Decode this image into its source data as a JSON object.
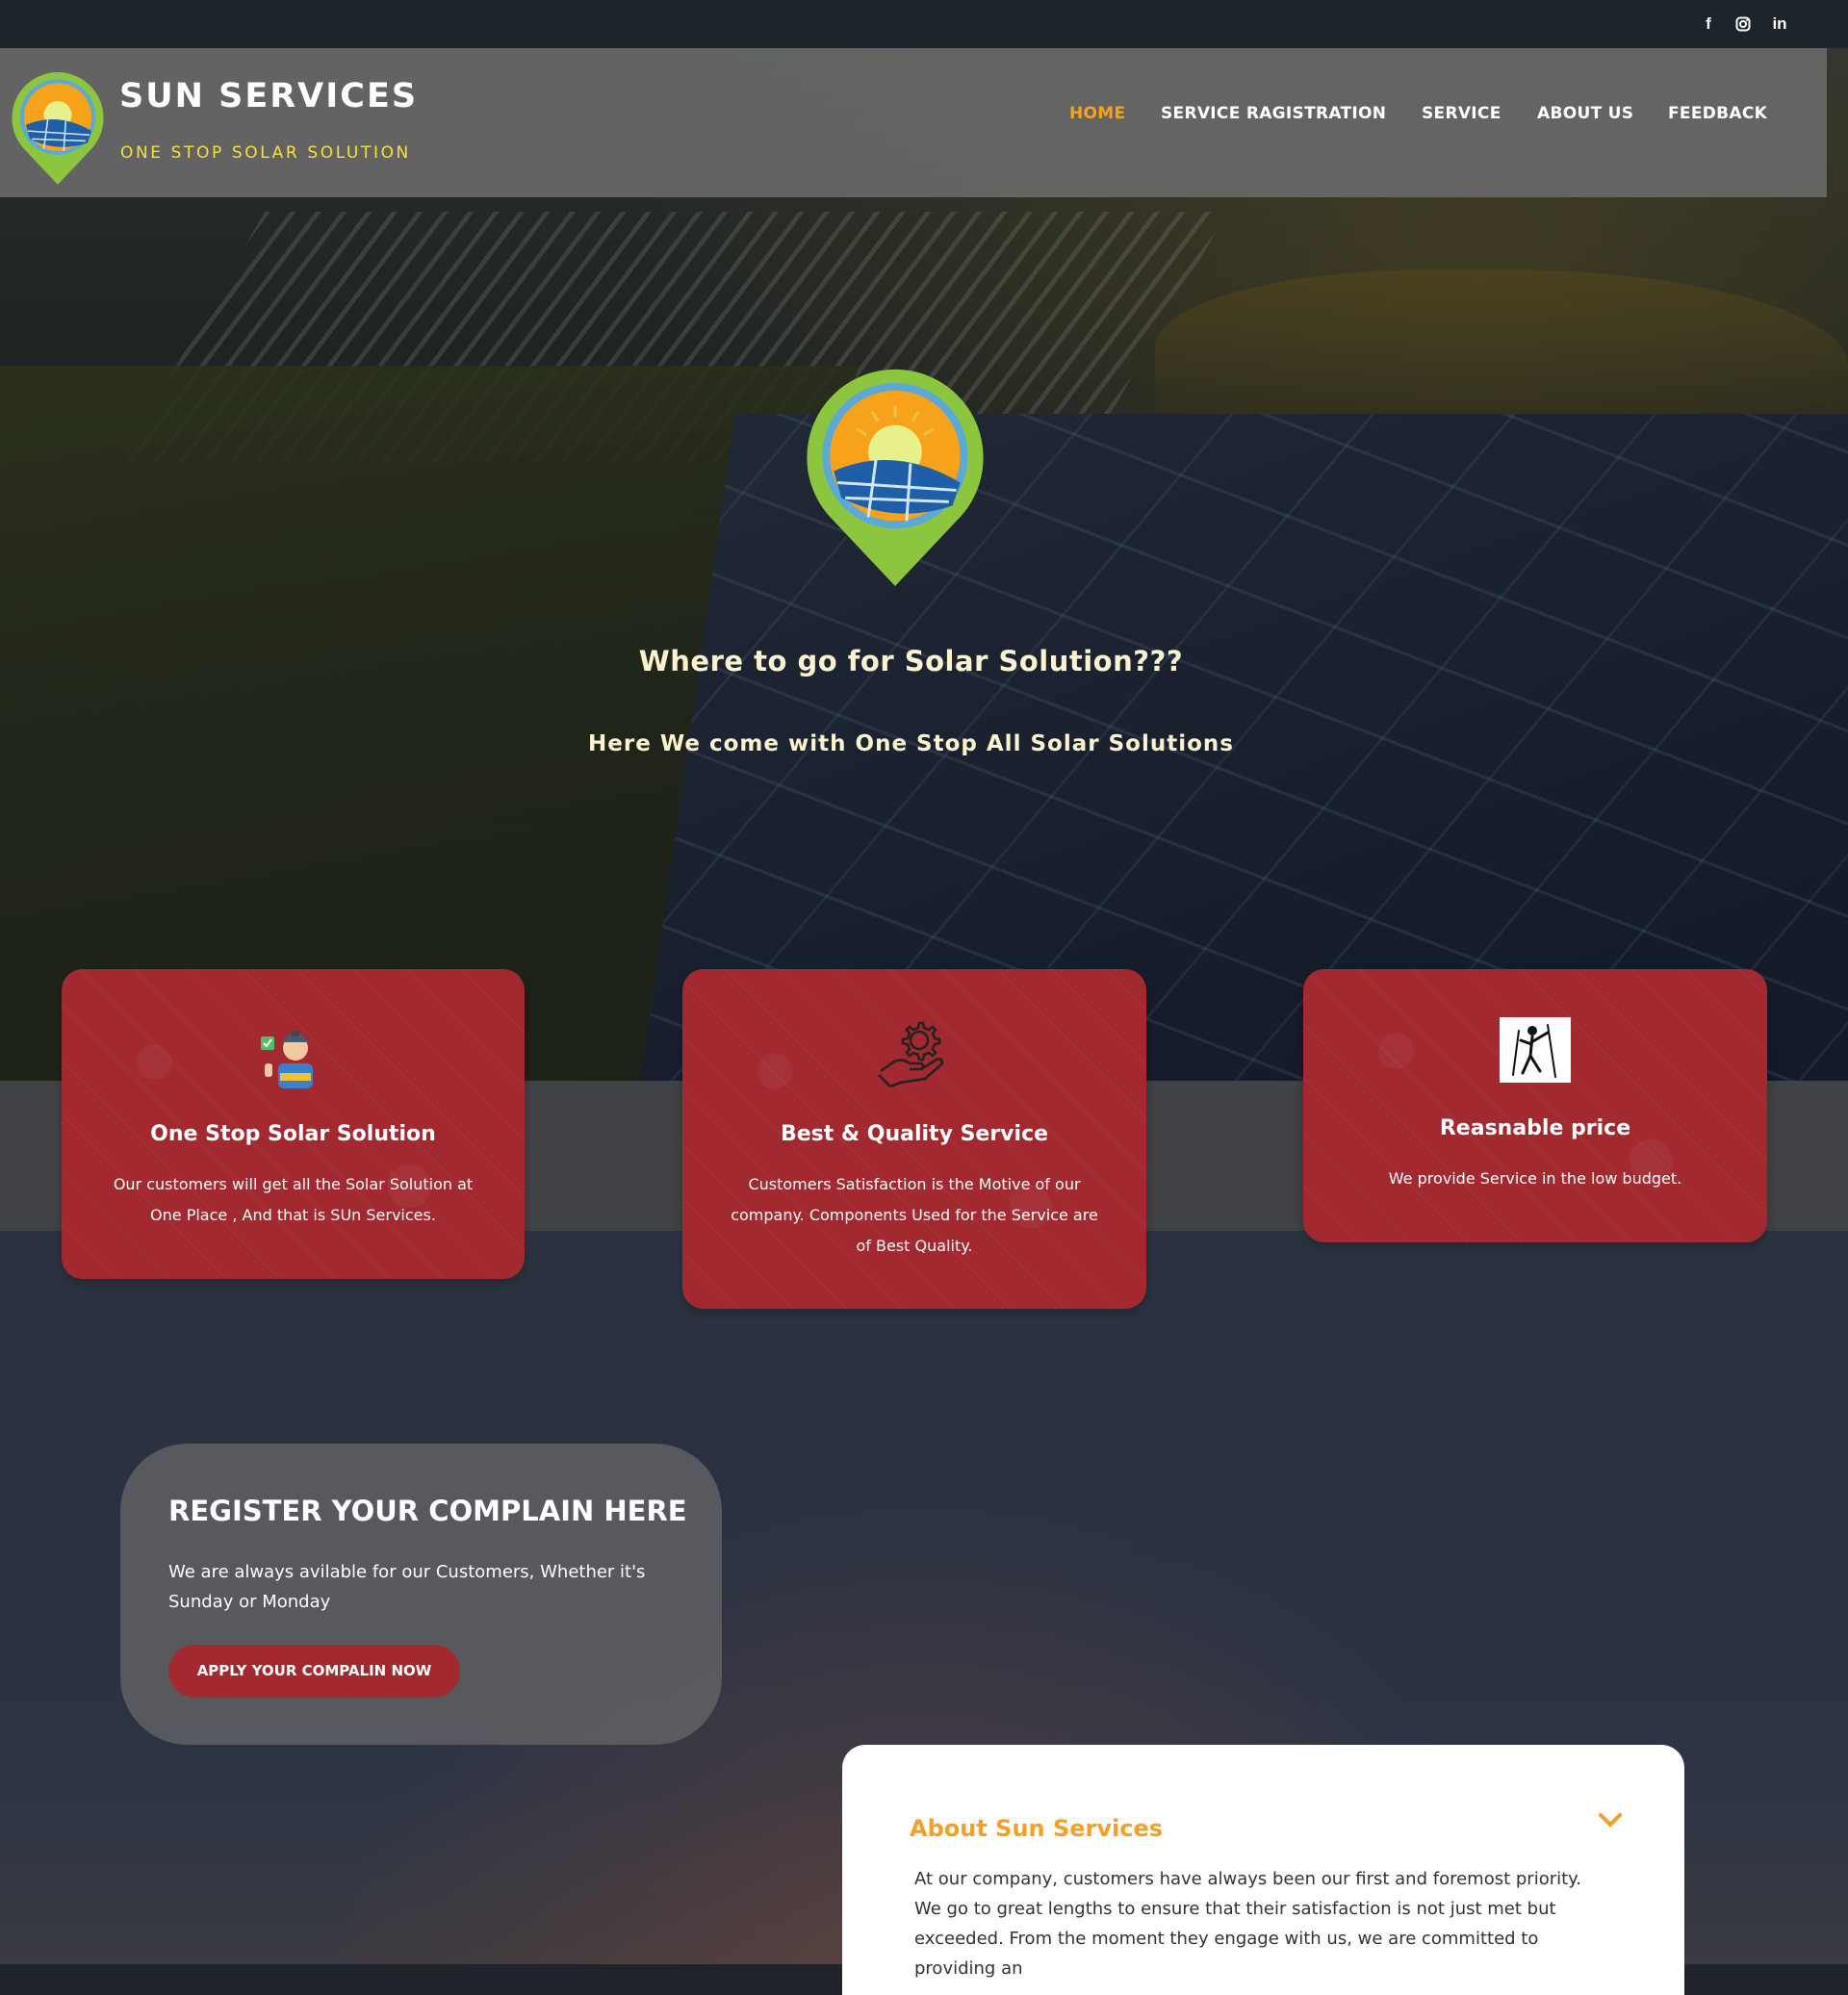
{
  "social": {
    "facebook": "f",
    "instagram": "◘",
    "linkedin": "in"
  },
  "brand": {
    "title": "SUN SERVICES",
    "tagline": "ONE STOP SOLAR SOLUTION",
    "logo_icon": "solar-pin-logo-icon"
  },
  "nav": {
    "items": [
      {
        "label": "HOME",
        "active": true
      },
      {
        "label": "SERVICE RAGISTRATION",
        "active": false
      },
      {
        "label": "SERVICE",
        "active": false
      },
      {
        "label": "ABOUT US",
        "active": false
      },
      {
        "label": "FEEDBACK",
        "active": false
      }
    ]
  },
  "hero": {
    "heading": "Where to go for Solar Solution???",
    "subheading": "Here We come with One Stop All Solar Solutions"
  },
  "features": [
    {
      "icon": "technician-icon",
      "title": "One Stop Solar Solution",
      "text": "Our customers will get all the Solar Solution at One Place , And that is SUn Services."
    },
    {
      "icon": "gear-hand-icon",
      "title": "Best & Quality Service",
      "text": "Customers Satisfaction is the Motive of our company. Components Used for the Service are of Best Quality."
    },
    {
      "icon": "worker-sign-icon",
      "title": "Reasnable price",
      "text": "We provide Service in the low budget."
    }
  ],
  "complain": {
    "title": "REGISTER YOUR COMPLAIN HERE",
    "text": "We are always avilable for our Customers, Whether it's Sunday or Monday",
    "button_label": "APPLY YOUR COMPALIN NOW"
  },
  "about": {
    "title": "About Sun Services",
    "text": "At our company, customers have always been our first and foremost priority. We go to great lengths to ensure that their satisfaction is not just met but exceeded. From the moment they engage with us, we are committed to providing an"
  },
  "colors": {
    "accent": "#f7a21b",
    "card": "#a1292f",
    "tagline": "#f4e13a",
    "about_title": "#f2a027"
  }
}
